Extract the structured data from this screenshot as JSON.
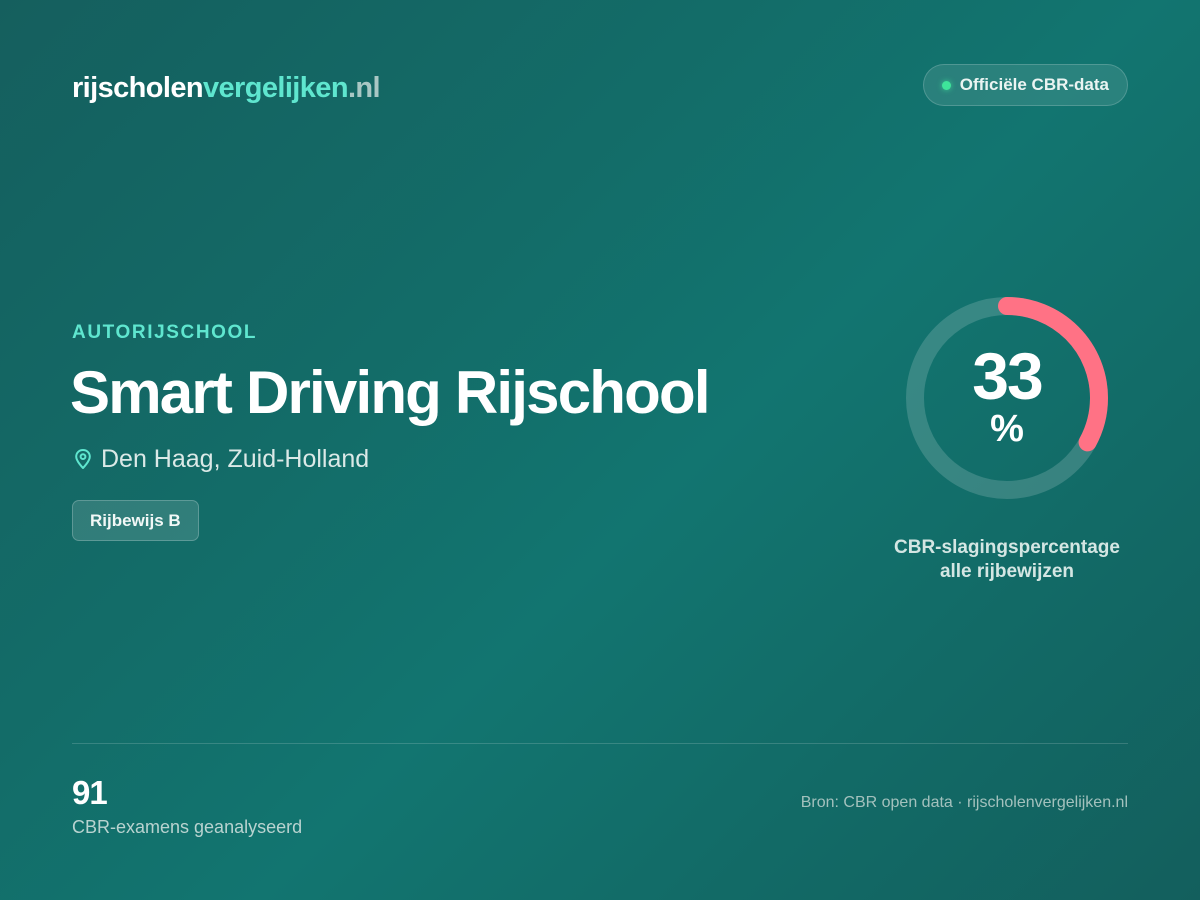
{
  "header": {
    "logo": {
      "part1": "rijscholen",
      "part2": "vergelijken",
      "part3": ".nl"
    },
    "badge_label": "Officiële CBR-data"
  },
  "school": {
    "category": "AUTORIJSCHOOL",
    "name": "Smart Driving Rijschool",
    "location": "Den Haag, Zuid-Holland",
    "license_tag": "Rijbewijs B"
  },
  "pass_rate": {
    "value": "33",
    "unit": "%",
    "fraction": 0.33,
    "caption_line1": "CBR-slagingspercentage",
    "caption_line2": "alle rijbewijzen"
  },
  "footer": {
    "exam_count": "91",
    "exam_label": "CBR-examens geanalyseerd",
    "source": "Bron: CBR open data · rijscholenvergelijken.nl"
  },
  "colors": {
    "accent": "#5fe6cf",
    "gauge_progress": "#ff7285",
    "status_dot": "#3ee49a"
  },
  "icons": {
    "location": "map-pin-icon",
    "status": "status-dot-icon"
  }
}
